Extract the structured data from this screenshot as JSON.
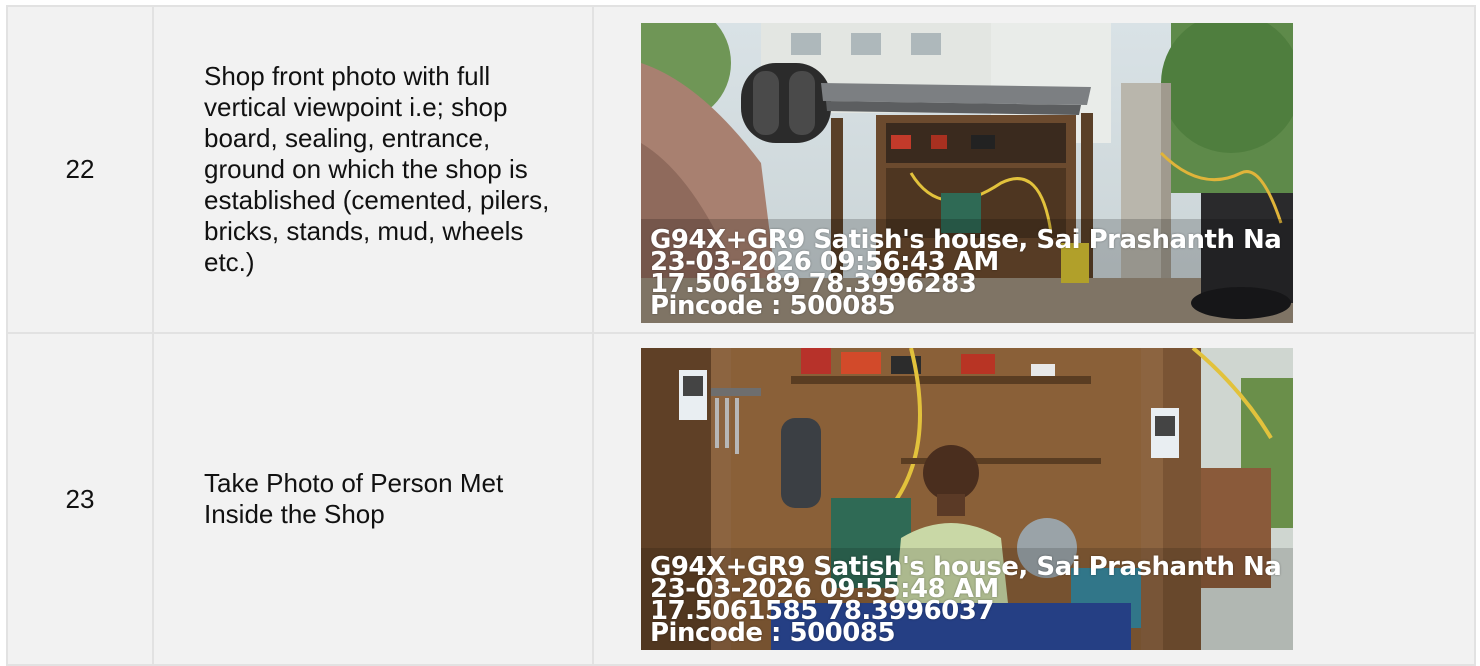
{
  "rows": [
    {
      "number": "22",
      "description": "Shop front photo with full vertical viewpoint i.e; shop board, sealing, entrance, ground on which the shop is established (cemented, pilers, bricks, stands, mud, wheels etc.)",
      "photo": {
        "stamp_address": "G94X+GR9 Satish's house, Sai Prashanth Na",
        "stamp_datetime": "23-03-2026 09:56:43 AM",
        "stamp_coords": "17.506189 78.3996283",
        "stamp_pincode": "Pincode : 500085"
      }
    },
    {
      "number": "23",
      "description": "Take Photo of Person Met Inside the Shop",
      "photo": {
        "stamp_address": "G94X+GR9 Satish's house, Sai Prashanth Na",
        "stamp_datetime": "23-03-2026 09:55:48 AM",
        "stamp_coords": "17.5061585 78.3996037",
        "stamp_pincode": "Pincode : 500085"
      }
    }
  ],
  "colors": {
    "cell_background": "#f2f2f2",
    "border": "#e2e2e2",
    "text": "#111111",
    "stamp_text": "#ffffff"
  }
}
